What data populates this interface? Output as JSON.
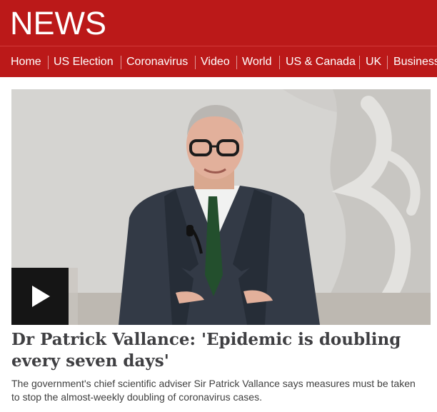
{
  "masthead": {
    "logo_text": "NEWS",
    "brand_color": "#bb1919"
  },
  "nav": {
    "items": [
      {
        "label": "Home"
      },
      {
        "label": "US Election"
      },
      {
        "label": "Coronavirus"
      },
      {
        "label": "Video"
      },
      {
        "label": "World"
      },
      {
        "label": "US & Canada"
      },
      {
        "label": "UK"
      },
      {
        "label": "Business"
      }
    ]
  },
  "story": {
    "headline": "Dr Patrick Vallance: 'Epidemic is doubling every seven days'",
    "summary": "The government's chief scientific adviser Sir Patrick Vallance says measures must be taken to stop the almost-weekly doubling of coronavirus cases.",
    "play_icon": "play-icon"
  }
}
